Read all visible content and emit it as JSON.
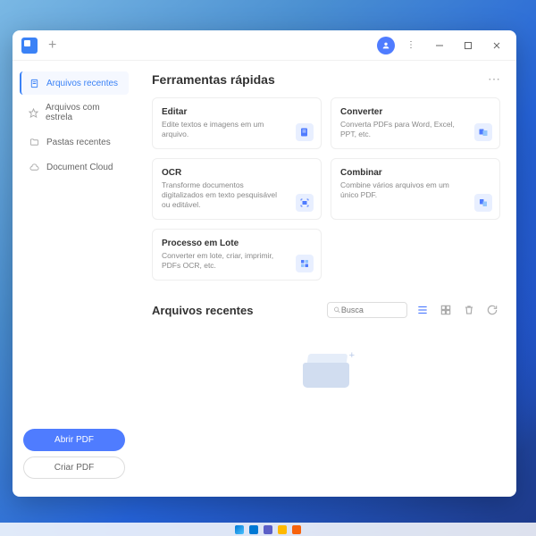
{
  "sidebar": {
    "items": [
      {
        "label": "Arquivos recentes",
        "active": true
      },
      {
        "label": "Arquivos com estrela",
        "active": false
      },
      {
        "label": "Pastas recentes",
        "active": false
      },
      {
        "label": "Document Cloud",
        "active": false
      }
    ],
    "open_pdf_label": "Abrir PDF",
    "create_pdf_label": "Criar PDF"
  },
  "quick_tools": {
    "title": "Ferramentas rápidas",
    "items": [
      {
        "title": "Editar",
        "desc": "Edite textos e imagens em um arquivo."
      },
      {
        "title": "Converter",
        "desc": "Converta PDFs para Word, Excel, PPT, etc."
      },
      {
        "title": "OCR",
        "desc": "Transforme documentos digitalizados em texto pesquisável ou editável."
      },
      {
        "title": "Combinar",
        "desc": "Combine vários arquivos em um único PDF."
      },
      {
        "title": "Processo em Lote",
        "desc": "Converter em lote, criar, imprimir, PDFs OCR, etc."
      }
    ]
  },
  "recent": {
    "title": "Arquivos recentes",
    "search_placeholder": "Busca"
  }
}
